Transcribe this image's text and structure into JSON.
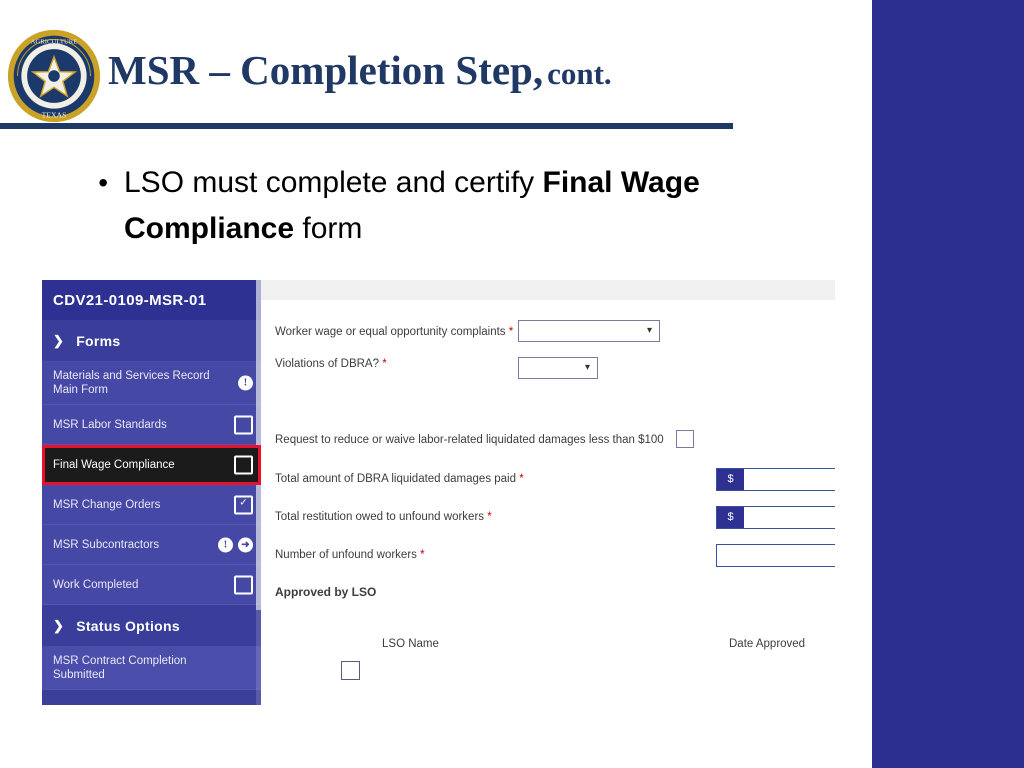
{
  "slide": {
    "title_main": "MSR – Completion Step,",
    "title_small": "cont.",
    "seal_alt": "texas-department-of-agriculture-seal"
  },
  "bullet": {
    "marker": "•",
    "text_before": "LSO must complete and certify ",
    "text_bold": "Final Wage Compliance",
    "text_after": " form"
  },
  "screenshot": {
    "nav": {
      "header": "CDV21-0109-MSR-01",
      "forms_section": "Forms",
      "status_section": "Status Options",
      "chevron": "❯",
      "items": [
        {
          "label": "Materials and Services Record Main Form",
          "icons": [
            "info-icon"
          ]
        },
        {
          "label": "MSR Labor Standards",
          "icons": [
            "square-icon"
          ]
        },
        {
          "label": "Final Wage Compliance",
          "icons": [
            "square-icon"
          ],
          "selected": true
        },
        {
          "label": "MSR Change Orders",
          "icons": [
            "check-square-icon"
          ]
        },
        {
          "label": "MSR Subcontractors",
          "icons": [
            "info-icon",
            "arrow-right-icon"
          ]
        },
        {
          "label": "Work Completed",
          "icons": [
            "square-icon"
          ]
        }
      ],
      "status_items": [
        {
          "label": "MSR Contract Completion Submitted",
          "icons": []
        }
      ]
    },
    "form": {
      "fields": [
        {
          "label": "Worker wage or equal opportunity complaints",
          "required": true,
          "control": "dropdown",
          "value": ""
        },
        {
          "label": "Violations of DBRA?",
          "required": true,
          "control": "dropdown",
          "value": ""
        },
        {
          "label": "Request to reduce or waive labor-related liquidated damages less than $100",
          "required": false,
          "control": "checkbox",
          "value": ""
        },
        {
          "label": "Total amount of DBRA liquidated damages paid",
          "required": true,
          "control": "currency",
          "prefix": "$",
          "value": ""
        },
        {
          "label": "Total restitution owed to unfound workers",
          "required": true,
          "control": "currency",
          "prefix": "$",
          "value": ""
        },
        {
          "label": "Number of unfound workers",
          "required": true,
          "control": "text",
          "value": ""
        }
      ],
      "approved_by": "Approved by LSO",
      "col_lso_name": "LSO Name",
      "col_date_approved": "Date Approved"
    }
  },
  "colors": {
    "brand_blue": "#2c2e90",
    "title_blue": "#1f3864",
    "nav_blue": "#4549a5",
    "selected_outline": "#e8102b",
    "required_red": "#c00000"
  }
}
